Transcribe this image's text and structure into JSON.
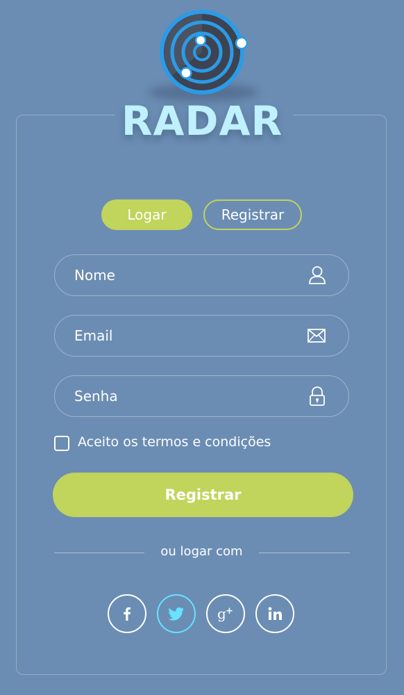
{
  "brand": {
    "title": "RADAR",
    "logo_icon": "radar-icon"
  },
  "colors": {
    "background": "#6b8db3",
    "accent": "#c1d45b",
    "brand_text": "#bff1ff",
    "twitter_ring": "#67e2ff"
  },
  "tabs": {
    "login_label": "Logar",
    "register_label": "Registrar",
    "active": "login"
  },
  "form": {
    "name_placeholder": "Nome",
    "name_value": "",
    "name_icon": "user-icon",
    "email_placeholder": "Email",
    "email_value": "",
    "email_icon": "envelope-icon",
    "password_placeholder": "Senha",
    "password_value": "",
    "password_icon": "lock-icon",
    "terms_label": "Aceito os termos e condições",
    "terms_checked": false,
    "submit_label": "Registrar"
  },
  "social": {
    "divider_text": "ou logar com",
    "buttons": [
      {
        "name": "facebook",
        "icon": "facebook-icon"
      },
      {
        "name": "twitter",
        "icon": "twitter-icon"
      },
      {
        "name": "google-plus",
        "icon": "google-plus-icon"
      },
      {
        "name": "linkedin",
        "icon": "linkedin-icon"
      }
    ]
  }
}
